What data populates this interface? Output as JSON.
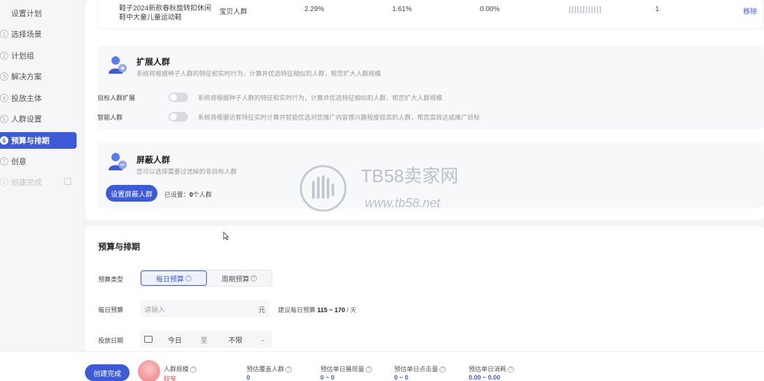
{
  "sidebar": {
    "steps": [
      {
        "num": "1",
        "label": "设置计划"
      },
      {
        "num": "1",
        "label": "选择场景"
      },
      {
        "num": "2",
        "label": "计划组"
      },
      {
        "num": "3",
        "label": "解决方案"
      },
      {
        "num": "4",
        "label": "投放主体"
      },
      {
        "num": "5",
        "label": "人群设置"
      },
      {
        "num": "6",
        "label": "预算与排期"
      },
      {
        "num": "7",
        "label": "创意"
      },
      {
        "num": "8",
        "label": "创建完成"
      }
    ]
  },
  "table_row": {
    "product_line1": "鞋子2024新款春秋旋转扣休闲",
    "product_line2": "鞋中大童儿童运动鞋",
    "crowd": "宝贝人群",
    "v1": "2.29%",
    "v2": "1.61%",
    "v3": "0.00%",
    "count": "1",
    "action": "移除"
  },
  "expand": {
    "title": "扩展人群",
    "desc": "系统将根据种子人群的特征和实时行为，计算并优选特征相似的人群，帮您扩大人群规模",
    "rows": [
      {
        "label": "目标人群扩展",
        "desc": "系统将根据种子人群的特征和实时行为，计算并优选特征相似的人群，帮您扩大人群规模"
      },
      {
        "label": "智能人群",
        "desc": "系统将根据访客特征实时计算并智能优选对您推广内容感兴趣程度较高的人群，帮您高效达成推广目标"
      }
    ]
  },
  "block": {
    "title": "屏蔽人群",
    "desc": "您可以选择需要过滤掉的非目标人群",
    "button": "设置屏蔽人群",
    "set_prefix": "已设置：",
    "set_count": "0",
    "set_suffix": "个人群"
  },
  "budget": {
    "title": "预算与排期",
    "type_label": "预算类型",
    "type_options": [
      "每日预算",
      "周期预算"
    ],
    "daily_label": "每日预算",
    "daily_placeholder": "请输入",
    "daily_unit": "元",
    "suggest_prefix": "建议每日预算",
    "suggest_range": "115 ~ 170",
    "suggest_suffix": "/ 天",
    "date_label": "投放日期",
    "date_start": "今日",
    "date_to": "至",
    "date_end": "不限"
  },
  "bottom": {
    "create_button": "创建完成",
    "scale_label": "人群规模",
    "scale_value": "较窄",
    "metrics": [
      {
        "label": "预估覆盖人群",
        "value": "0"
      },
      {
        "label": "预估单日展现量",
        "value": "0 ~ 0"
      },
      {
        "label": "预估单日点击量",
        "value": "0 ~ 0"
      },
      {
        "label": "预估单日消耗",
        "value": "0.00 ~ 0.00"
      }
    ]
  },
  "watermark": {
    "name": "TB58卖家网",
    "url": "www.tb58.net"
  },
  "colors": {
    "accent": "#3d5bd9"
  }
}
